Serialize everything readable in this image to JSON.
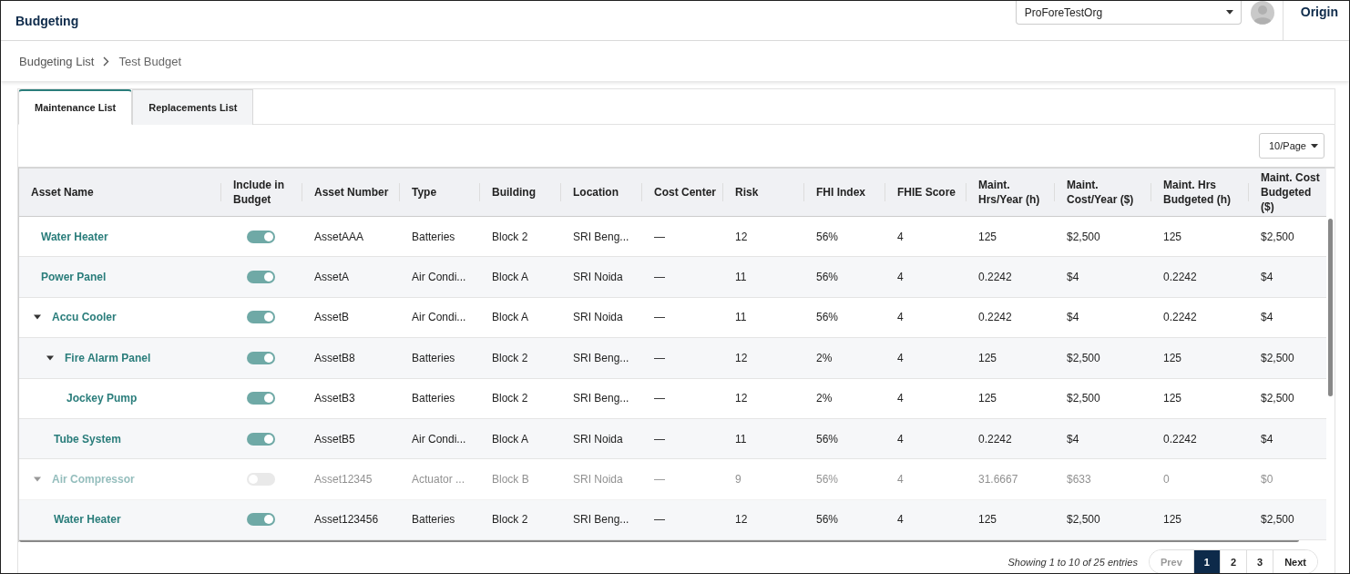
{
  "app_title": "Budgeting",
  "org_select": {
    "value": "ProForeTestOrg"
  },
  "user_name": "Origin",
  "breadcrumb": [
    "Budgeting List",
    "Test Budget"
  ],
  "tabs": [
    {
      "label": "Maintenance List",
      "selected": true
    },
    {
      "label": "Replacements List",
      "selected": false
    }
  ],
  "page_size": "10/Page",
  "columns": [
    "Asset Name",
    "Include in Budget",
    "Asset Number",
    "Type",
    "Building",
    "Location",
    "Cost Center",
    "Risk",
    "FHI Index",
    "FHIE Score",
    "Maint. Hrs/Year (h)",
    "Maint. Cost/Year ($)",
    "Maint. Hrs Budgeted (h)",
    "Maint. Cost Budgeted ($)"
  ],
  "rows": [
    {
      "name": "Water Heater",
      "included": true,
      "cells": [
        "AssetAAA",
        "Batteries",
        "Block 2",
        "SRI Beng...",
        "—",
        "12",
        "56%",
        "4",
        "125",
        "$2,500",
        "125",
        "$2,500"
      ]
    },
    {
      "name": "Power Panel",
      "included": true,
      "cells": [
        "AssetA",
        "Air Condi...",
        "Block A",
        "SRI Noida",
        "—",
        "11",
        "56%",
        "4",
        "0.2242",
        "$4",
        "0.2242",
        "$4"
      ]
    },
    {
      "name": "Accu Cooler",
      "included": true,
      "expanded": true,
      "cells": [
        "AssetB",
        "Air Condi...",
        "Block A",
        "SRI Noida",
        "—",
        "11",
        "56%",
        "4",
        "0.2242",
        "$4",
        "0.2242",
        "$4"
      ],
      "children": [
        {
          "name": "Fire Alarm Panel",
          "included": true,
          "expanded": true,
          "cells": [
            "AssetB8",
            "Batteries",
            "Block 2",
            "SRI Beng...",
            "—",
            "12",
            "2%",
            "4",
            "125",
            "$2,500",
            "125",
            "$2,500"
          ],
          "children": [
            {
              "name": "Jockey Pump",
              "included": true,
              "cells": [
                "AssetB3",
                "Batteries",
                "Block 2",
                "SRI Beng...",
                "—",
                "12",
                "2%",
                "4",
                "125",
                "$2,500",
                "125",
                "$2,500"
              ]
            }
          ]
        },
        {
          "name": "Tube System",
          "included": true,
          "cells": [
            "AssetB5",
            "Air Condi...",
            "Block A",
            "SRI Noida",
            "—",
            "11",
            "56%",
            "4",
            "0.2242",
            "$4",
            "0.2242",
            "$4"
          ]
        }
      ]
    },
    {
      "name": "Air Compressor",
      "included": false,
      "expanded": true,
      "cells": [
        "Asset12345",
        "Actuator ...",
        "Block B",
        "SRI Noida",
        "—",
        "9",
        "56%",
        "4",
        "31.6667",
        "$633",
        "0",
        "$0"
      ],
      "children": [
        {
          "name": "Water Heater",
          "included": true,
          "cells": [
            "Asset123456",
            "Batteries",
            "Block 2",
            "SRI Beng...",
            "—",
            "12",
            "56%",
            "4",
            "125",
            "$2,500",
            "125",
            "$2,500"
          ]
        }
      ]
    }
  ],
  "entries_info": "Showing 1 to 10 of 25 entries",
  "pagination": {
    "prev": "Prev",
    "next": "Next",
    "pages": [
      {
        "label": "1",
        "selected": true
      },
      {
        "label": "2",
        "selected": false
      },
      {
        "label": "3",
        "selected": false
      }
    ]
  }
}
